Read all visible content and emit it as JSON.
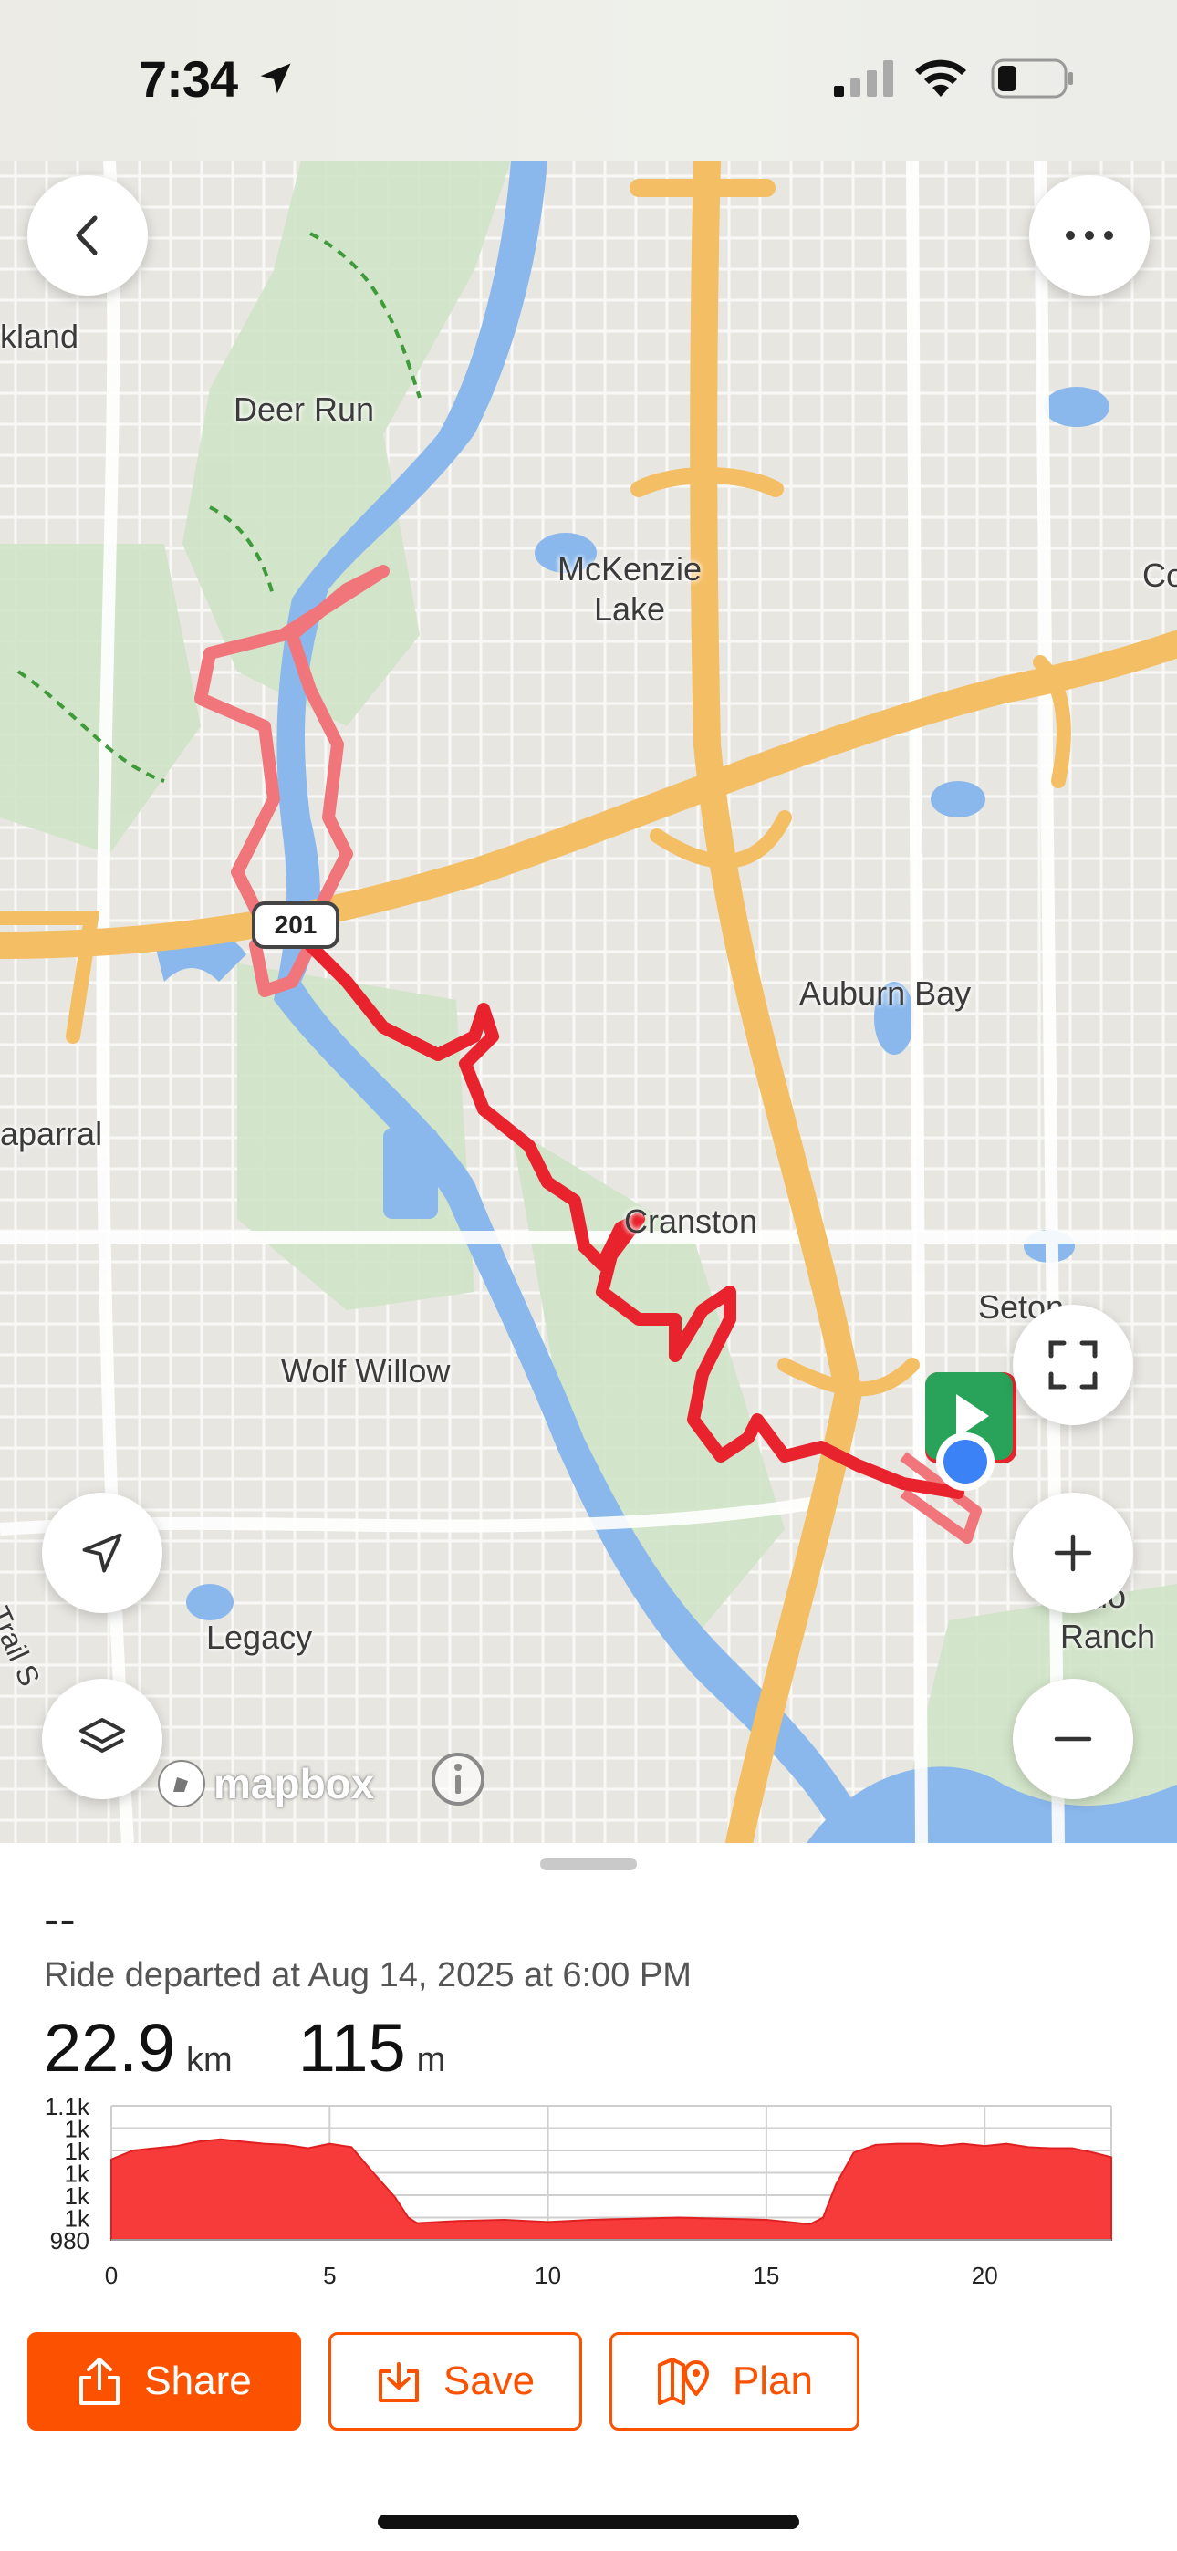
{
  "status_bar": {
    "time": "7:34"
  },
  "map": {
    "labels": {
      "kland": "kland",
      "deer_run": "Deer Run",
      "mckenzie_lake": "McKenzie Lake",
      "co": "Co",
      "auburn_bay": "Auburn Bay",
      "aparral": "aparral",
      "cranston": "Cranston",
      "seton": "Seton",
      "wolf_willow": "Wolf Willow",
      "legacy": "Legacy",
      "mahogany_ranch": "ardo Ranch",
      "trail": "Trail S"
    },
    "route_badge": "201",
    "attribution": "mapbox",
    "colors": {
      "route": "#e8232e",
      "route_faded": "#f0767b",
      "highway": "#f4be64",
      "water": "#8ab8ec",
      "park": "#cfe3c6",
      "start_marker": "#2aa35a",
      "location": "#3b82f6"
    }
  },
  "ride": {
    "title": "--",
    "departed": "Ride departed at Aug 14, 2025 at 6:00 PM",
    "distance_value": "22.9",
    "distance_unit": "km",
    "elevation_value": "115",
    "elevation_unit": "m"
  },
  "chart_data": {
    "type": "area",
    "title": "",
    "xlabel": "",
    "ylabel": "",
    "x_ticks": [
      "0",
      "5",
      "10",
      "15",
      "20"
    ],
    "y_ticks": [
      "1.1k",
      "1k",
      "1k",
      "1k",
      "1k",
      "1k",
      "980"
    ],
    "xlim": [
      0,
      22.9
    ],
    "ylim": [
      980,
      1100
    ],
    "series": [
      {
        "x": [
          0,
          0.5,
          1,
          1.5,
          2,
          2.5,
          3,
          3.5,
          4,
          4.5,
          5,
          5.5,
          6,
          6.5,
          6.8,
          7,
          7.5,
          8,
          9,
          10,
          11,
          12,
          13,
          14,
          15,
          15.5,
          16,
          16.3,
          16.6,
          17,
          17.5,
          18,
          18.5,
          19,
          19.5,
          20,
          20.5,
          21,
          21.5,
          22,
          22.5,
          22.9
        ],
        "values": [
          1052,
          1060,
          1062,
          1064,
          1068,
          1070,
          1068,
          1066,
          1065,
          1062,
          1066,
          1063,
          1040,
          1018,
          1000,
          995,
          996,
          997,
          998,
          996,
          998,
          999,
          1000,
          999,
          998,
          996,
          994,
          1000,
          1030,
          1058,
          1065,
          1066,
          1066,
          1064,
          1066,
          1064,
          1066,
          1063,
          1062,
          1062,
          1058,
          1054
        ]
      }
    ],
    "grid": true,
    "color": "#f73a3a"
  },
  "actions": {
    "share": "Share",
    "save": "Save",
    "plan": "Plan"
  }
}
